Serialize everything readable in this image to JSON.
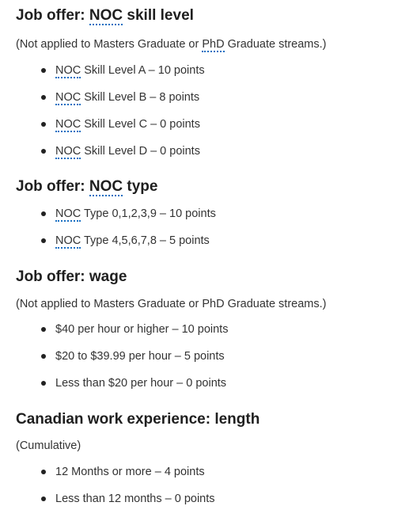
{
  "sections": [
    {
      "heading_prefix": "Job offer: ",
      "heading_abbr": "NOC",
      "heading_suffix": " skill level",
      "note_prefix": "(Not applied to Masters Graduate or ",
      "note_abbr": "PhD",
      "note_suffix": " Graduate streams.)",
      "items": [
        {
          "abbr": "NOC",
          "text": " Skill Level A – 10 points"
        },
        {
          "abbr": "NOC",
          "text": " Skill Level B – 8 points"
        },
        {
          "abbr": "NOC",
          "text": " Skill Level C – 0 points"
        },
        {
          "abbr": "NOC",
          "text": " Skill Level D – 0 points"
        }
      ]
    },
    {
      "heading_prefix": "Job offer: ",
      "heading_abbr": "NOC",
      "heading_suffix": " type",
      "items": [
        {
          "abbr": "NOC",
          "text": " Type 0,1,2,3,9 – 10 points"
        },
        {
          "abbr": "NOC",
          "text": " Type 4,5,6,7,8 – 5 points"
        }
      ]
    },
    {
      "heading": "Job offer: wage",
      "note": "(Not applied to Masters Graduate or PhD Graduate streams.)",
      "items": [
        "$40 per hour or higher – 10 points",
        "$20 to $39.99 per hour – 5 points",
        "Less than $20 per hour – 0 points"
      ]
    },
    {
      "heading": "Canadian work experience: length",
      "note": "(Cumulative)",
      "items": [
        "12 Months or more – 4 points",
        "Less than 12 months – 0 points"
      ]
    }
  ]
}
